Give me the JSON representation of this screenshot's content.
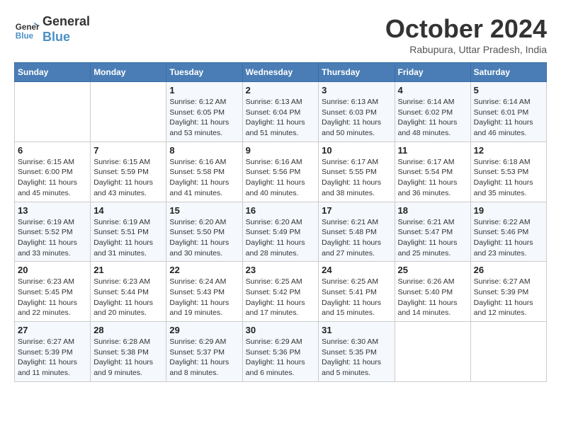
{
  "header": {
    "logo_line1": "General",
    "logo_line2": "Blue",
    "month": "October 2024",
    "location": "Rabupura, Uttar Pradesh, India"
  },
  "weekdays": [
    "Sunday",
    "Monday",
    "Tuesday",
    "Wednesday",
    "Thursday",
    "Friday",
    "Saturday"
  ],
  "weeks": [
    [
      {
        "day": "",
        "info": ""
      },
      {
        "day": "",
        "info": ""
      },
      {
        "day": "1",
        "info": "Sunrise: 6:12 AM\nSunset: 6:05 PM\nDaylight: 11 hours and 53 minutes."
      },
      {
        "day": "2",
        "info": "Sunrise: 6:13 AM\nSunset: 6:04 PM\nDaylight: 11 hours and 51 minutes."
      },
      {
        "day": "3",
        "info": "Sunrise: 6:13 AM\nSunset: 6:03 PM\nDaylight: 11 hours and 50 minutes."
      },
      {
        "day": "4",
        "info": "Sunrise: 6:14 AM\nSunset: 6:02 PM\nDaylight: 11 hours and 48 minutes."
      },
      {
        "day": "5",
        "info": "Sunrise: 6:14 AM\nSunset: 6:01 PM\nDaylight: 11 hours and 46 minutes."
      }
    ],
    [
      {
        "day": "6",
        "info": "Sunrise: 6:15 AM\nSunset: 6:00 PM\nDaylight: 11 hours and 45 minutes."
      },
      {
        "day": "7",
        "info": "Sunrise: 6:15 AM\nSunset: 5:59 PM\nDaylight: 11 hours and 43 minutes."
      },
      {
        "day": "8",
        "info": "Sunrise: 6:16 AM\nSunset: 5:58 PM\nDaylight: 11 hours and 41 minutes."
      },
      {
        "day": "9",
        "info": "Sunrise: 6:16 AM\nSunset: 5:56 PM\nDaylight: 11 hours and 40 minutes."
      },
      {
        "day": "10",
        "info": "Sunrise: 6:17 AM\nSunset: 5:55 PM\nDaylight: 11 hours and 38 minutes."
      },
      {
        "day": "11",
        "info": "Sunrise: 6:17 AM\nSunset: 5:54 PM\nDaylight: 11 hours and 36 minutes."
      },
      {
        "day": "12",
        "info": "Sunrise: 6:18 AM\nSunset: 5:53 PM\nDaylight: 11 hours and 35 minutes."
      }
    ],
    [
      {
        "day": "13",
        "info": "Sunrise: 6:19 AM\nSunset: 5:52 PM\nDaylight: 11 hours and 33 minutes."
      },
      {
        "day": "14",
        "info": "Sunrise: 6:19 AM\nSunset: 5:51 PM\nDaylight: 11 hours and 31 minutes."
      },
      {
        "day": "15",
        "info": "Sunrise: 6:20 AM\nSunset: 5:50 PM\nDaylight: 11 hours and 30 minutes."
      },
      {
        "day": "16",
        "info": "Sunrise: 6:20 AM\nSunset: 5:49 PM\nDaylight: 11 hours and 28 minutes."
      },
      {
        "day": "17",
        "info": "Sunrise: 6:21 AM\nSunset: 5:48 PM\nDaylight: 11 hours and 27 minutes."
      },
      {
        "day": "18",
        "info": "Sunrise: 6:21 AM\nSunset: 5:47 PM\nDaylight: 11 hours and 25 minutes."
      },
      {
        "day": "19",
        "info": "Sunrise: 6:22 AM\nSunset: 5:46 PM\nDaylight: 11 hours and 23 minutes."
      }
    ],
    [
      {
        "day": "20",
        "info": "Sunrise: 6:23 AM\nSunset: 5:45 PM\nDaylight: 11 hours and 22 minutes."
      },
      {
        "day": "21",
        "info": "Sunrise: 6:23 AM\nSunset: 5:44 PM\nDaylight: 11 hours and 20 minutes."
      },
      {
        "day": "22",
        "info": "Sunrise: 6:24 AM\nSunset: 5:43 PM\nDaylight: 11 hours and 19 minutes."
      },
      {
        "day": "23",
        "info": "Sunrise: 6:25 AM\nSunset: 5:42 PM\nDaylight: 11 hours and 17 minutes."
      },
      {
        "day": "24",
        "info": "Sunrise: 6:25 AM\nSunset: 5:41 PM\nDaylight: 11 hours and 15 minutes."
      },
      {
        "day": "25",
        "info": "Sunrise: 6:26 AM\nSunset: 5:40 PM\nDaylight: 11 hours and 14 minutes."
      },
      {
        "day": "26",
        "info": "Sunrise: 6:27 AM\nSunset: 5:39 PM\nDaylight: 11 hours and 12 minutes."
      }
    ],
    [
      {
        "day": "27",
        "info": "Sunrise: 6:27 AM\nSunset: 5:39 PM\nDaylight: 11 hours and 11 minutes."
      },
      {
        "day": "28",
        "info": "Sunrise: 6:28 AM\nSunset: 5:38 PM\nDaylight: 11 hours and 9 minutes."
      },
      {
        "day": "29",
        "info": "Sunrise: 6:29 AM\nSunset: 5:37 PM\nDaylight: 11 hours and 8 minutes."
      },
      {
        "day": "30",
        "info": "Sunrise: 6:29 AM\nSunset: 5:36 PM\nDaylight: 11 hours and 6 minutes."
      },
      {
        "day": "31",
        "info": "Sunrise: 6:30 AM\nSunset: 5:35 PM\nDaylight: 11 hours and 5 minutes."
      },
      {
        "day": "",
        "info": ""
      },
      {
        "day": "",
        "info": ""
      }
    ]
  ]
}
